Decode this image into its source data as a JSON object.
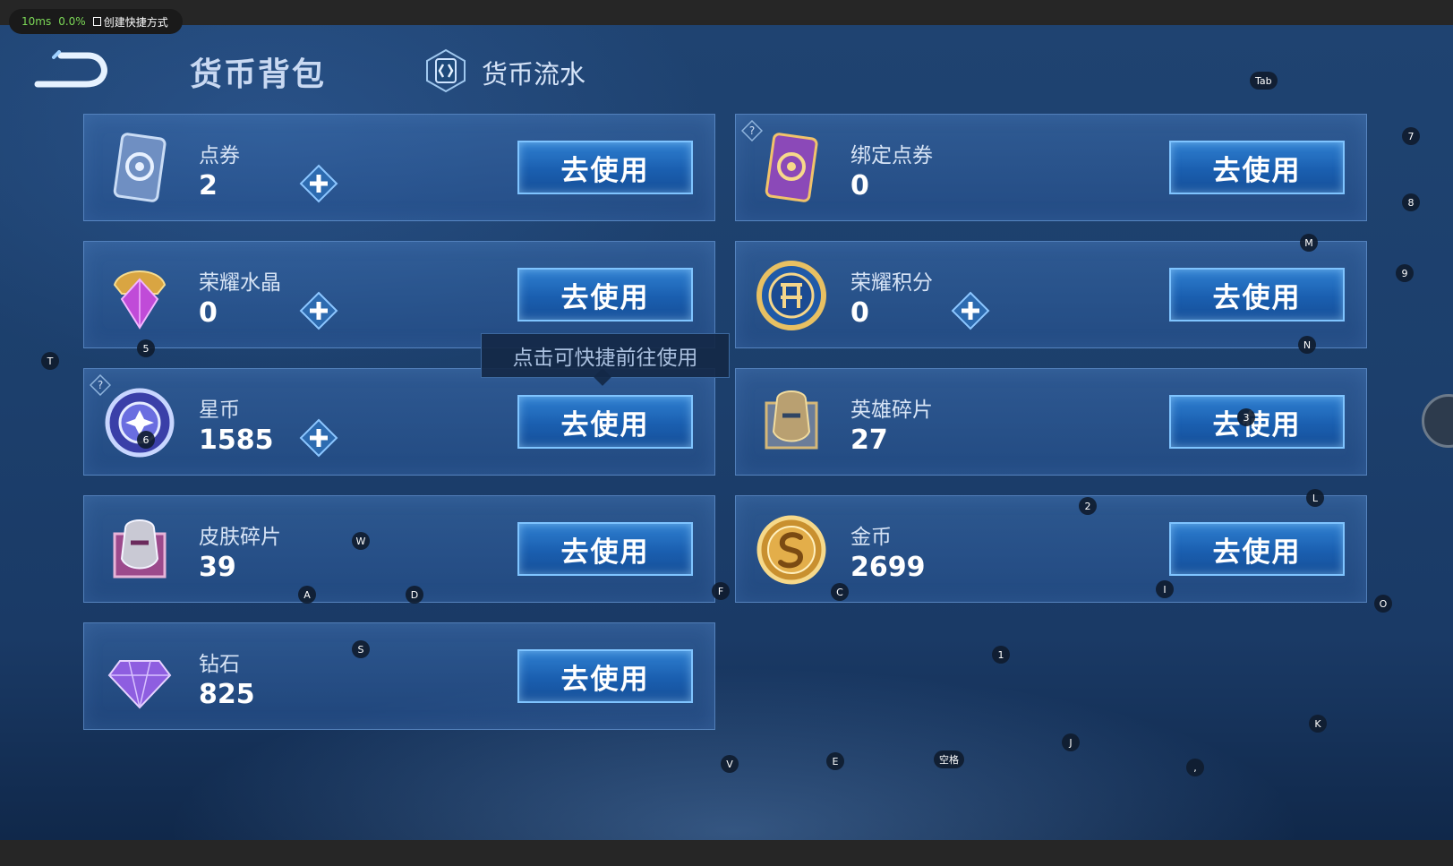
{
  "overlay": {
    "latency": "10ms",
    "cpu": "0.0%",
    "shortcut_label": "创建快捷方式"
  },
  "header": {
    "title": "货币背包",
    "tab_flow": "货币流水"
  },
  "cards": [
    {
      "name": "点券",
      "amount": "2",
      "button": "去使用"
    },
    {
      "name": "绑定点券",
      "amount": "0",
      "button": "去使用"
    },
    {
      "name": "荣耀水晶",
      "amount": "0",
      "button": "去使用"
    },
    {
      "name": "荣耀积分",
      "amount": "0",
      "button": "去使用"
    },
    {
      "name": "星币",
      "amount": "1585",
      "button": "去使用"
    },
    {
      "name": "英雄碎片",
      "amount": "27",
      "button": "去使用"
    },
    {
      "name": "皮肤碎片",
      "amount": "39",
      "button": "去使用"
    },
    {
      "name": "金币",
      "amount": "2699",
      "button": "去使用"
    },
    {
      "name": "钻石",
      "amount": "825",
      "button": "去使用"
    }
  ],
  "tooltip": "点击可快捷前往使用",
  "keys": {
    "tab": "Tab",
    "k7": "7",
    "k8": "8",
    "k9": "9",
    "M": "M",
    "N": "N",
    "T": "T",
    "k5": "5",
    "k6": "6",
    "k3": "3",
    "k2": "2",
    "L": "L",
    "W": "W",
    "A": "A",
    "D": "D",
    "F": "F",
    "C": "C",
    "I": "I",
    "O": "O",
    "S": "S",
    "k1": "1",
    "K": "K",
    "J": "J",
    "V": "V",
    "E": "E",
    "space": "空格",
    "comma": ","
  },
  "colors": {
    "accent": "#2f7fd0",
    "button_border": "#7fc4ff",
    "background": "#1c3f6c"
  },
  "icons": {
    "back": "back-arrow-icon",
    "flow": "currency-flow-icon",
    "plus": "plus-icon",
    "help": "question-icon"
  }
}
